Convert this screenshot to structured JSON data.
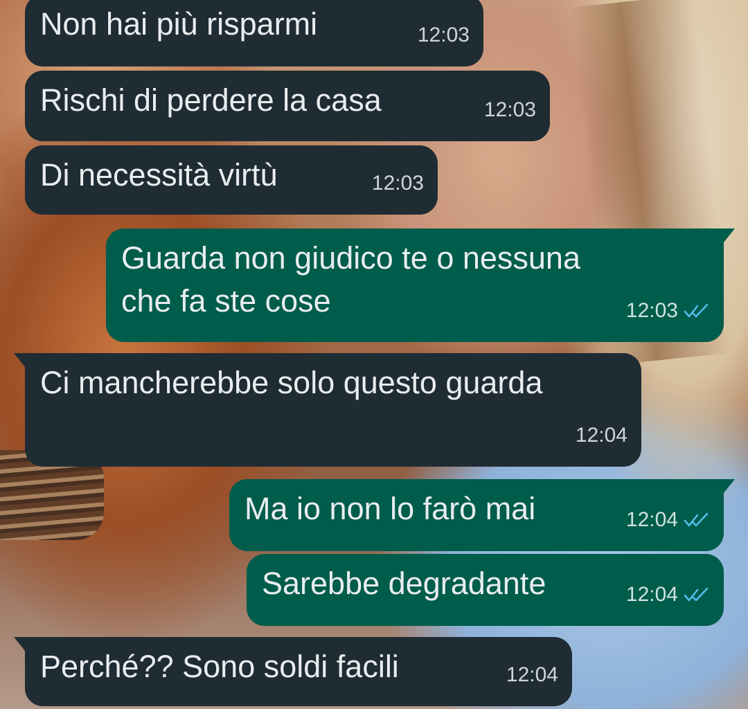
{
  "colors": {
    "incoming_bubble": "#202c33",
    "outgoing_bubble": "#005c4b",
    "text": "#e9edef",
    "read_ticks": "#53bdeb"
  },
  "messages": [
    {
      "direction": "incoming",
      "text": "Non hai più risparmi",
      "time": "12:03"
    },
    {
      "direction": "incoming",
      "text": "Rischi di perdere la casa",
      "time": "12:03"
    },
    {
      "direction": "incoming",
      "text": "Di necessità virtù",
      "time": "12:03"
    },
    {
      "direction": "outgoing",
      "text": "Guarda non giudico te o nessuna\nche fa ste cose",
      "time": "12:03",
      "status_icon": "double-check-read-icon"
    },
    {
      "direction": "incoming",
      "text": "Ci mancherebbe solo questo guarda",
      "time": "12:04"
    },
    {
      "direction": "outgoing",
      "text": "Ma io non lo farò mai",
      "time": "12:04",
      "status_icon": "double-check-read-icon"
    },
    {
      "direction": "outgoing",
      "text": "Sarebbe degradante",
      "time": "12:04",
      "status_icon": "double-check-read-icon"
    },
    {
      "direction": "incoming",
      "text": "Perché?? Sono soldi facili",
      "time": "12:04"
    }
  ]
}
